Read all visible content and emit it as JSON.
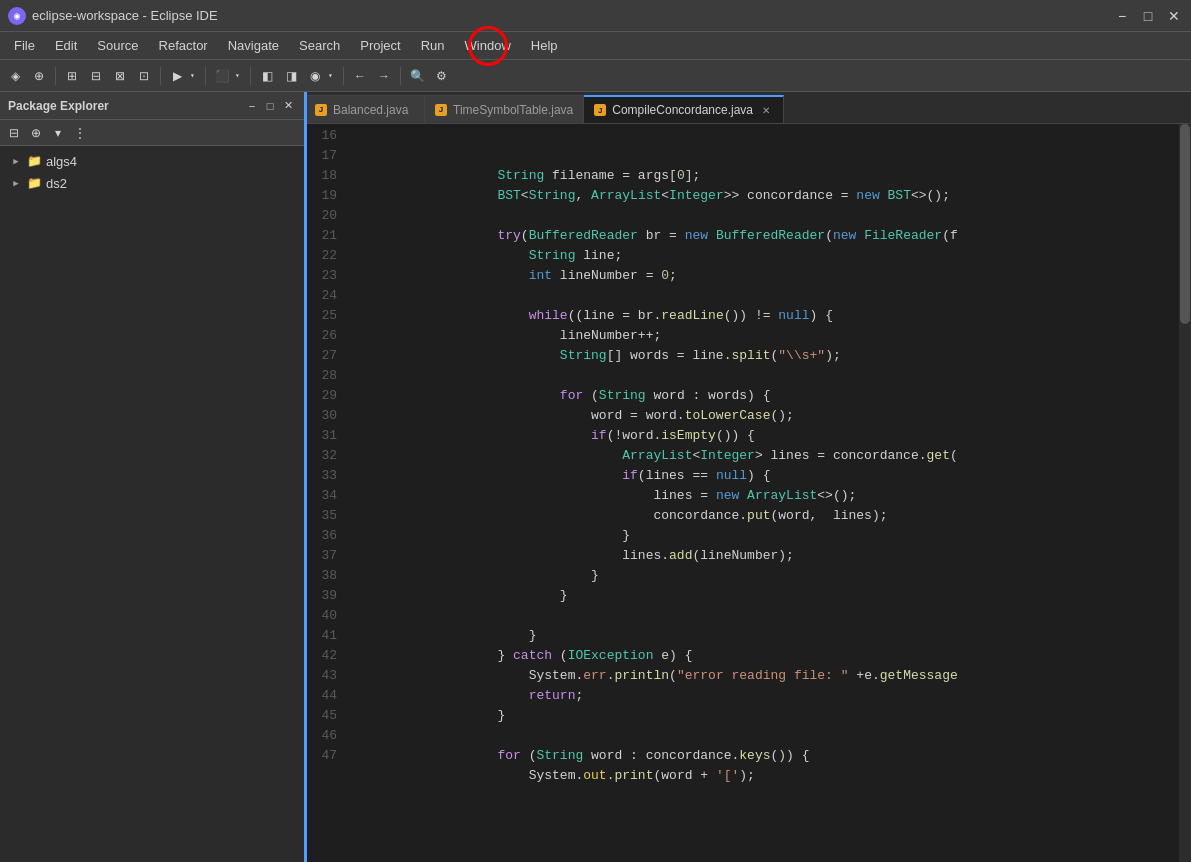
{
  "titleBar": {
    "icon": "◉",
    "title": "eclipse-workspace - Eclipse IDE",
    "minimize": "−",
    "maximize": "□",
    "close": "✕"
  },
  "menuBar": {
    "items": [
      "File",
      "Edit",
      "Source",
      "Refactor",
      "Navigate",
      "Search",
      "Project",
      "Run",
      "Window",
      "Help"
    ]
  },
  "sidebar": {
    "title": "Package Explorer",
    "closeBtn": "✕",
    "minBtn": "−",
    "maxBtn": "□",
    "trees": [
      {
        "label": "algs4",
        "type": "folder",
        "indent": 0
      },
      {
        "label": "ds2",
        "type": "folder",
        "indent": 0
      }
    ]
  },
  "editor": {
    "tabs": [
      {
        "label": "Balanced.java",
        "active": false,
        "closeable": false
      },
      {
        "label": "TimeSymbolTable.java",
        "active": false,
        "closeable": false
      },
      {
        "label": "CompileConcordance.java",
        "active": true,
        "closeable": true
      }
    ]
  },
  "code": {
    "startLine": 16,
    "lines": [
      "",
      "        String filename = args[0];",
      "        BST<String, ArrayList<Integer>> concordance = new BST<>();",
      "",
      "        try(BufferedReader br = new BufferedReader(new FileReader(f",
      "            String line;",
      "            int lineNumber = 0;",
      "",
      "            while((line = br.readLine()) != null) {",
      "                lineNumber++;",
      "                String[] words = line.split(\"\\\\s+\");",
      "",
      "                for (String word : words) {",
      "                    word = word.toLowerCase();",
      "                    if(!word.isEmpty()) {",
      "                        ArrayList<Integer> lines = concordance.get(",
      "                        if(lines == null) {",
      "                            lines = new ArrayList<>();",
      "                            concordance.put(word,  lines);",
      "                        }",
      "                        lines.add(lineNumber);",
      "                    }",
      "                }",
      "            }",
      "",
      "        } catch (IOException e) {",
      "            System.err.println(\"error reading file: \" +e.getMessage",
      "            return;",
      "        }",
      "",
      "        for (String word : concordance.keys()) {",
      "            System.out.print(word + '[');"
    ]
  }
}
